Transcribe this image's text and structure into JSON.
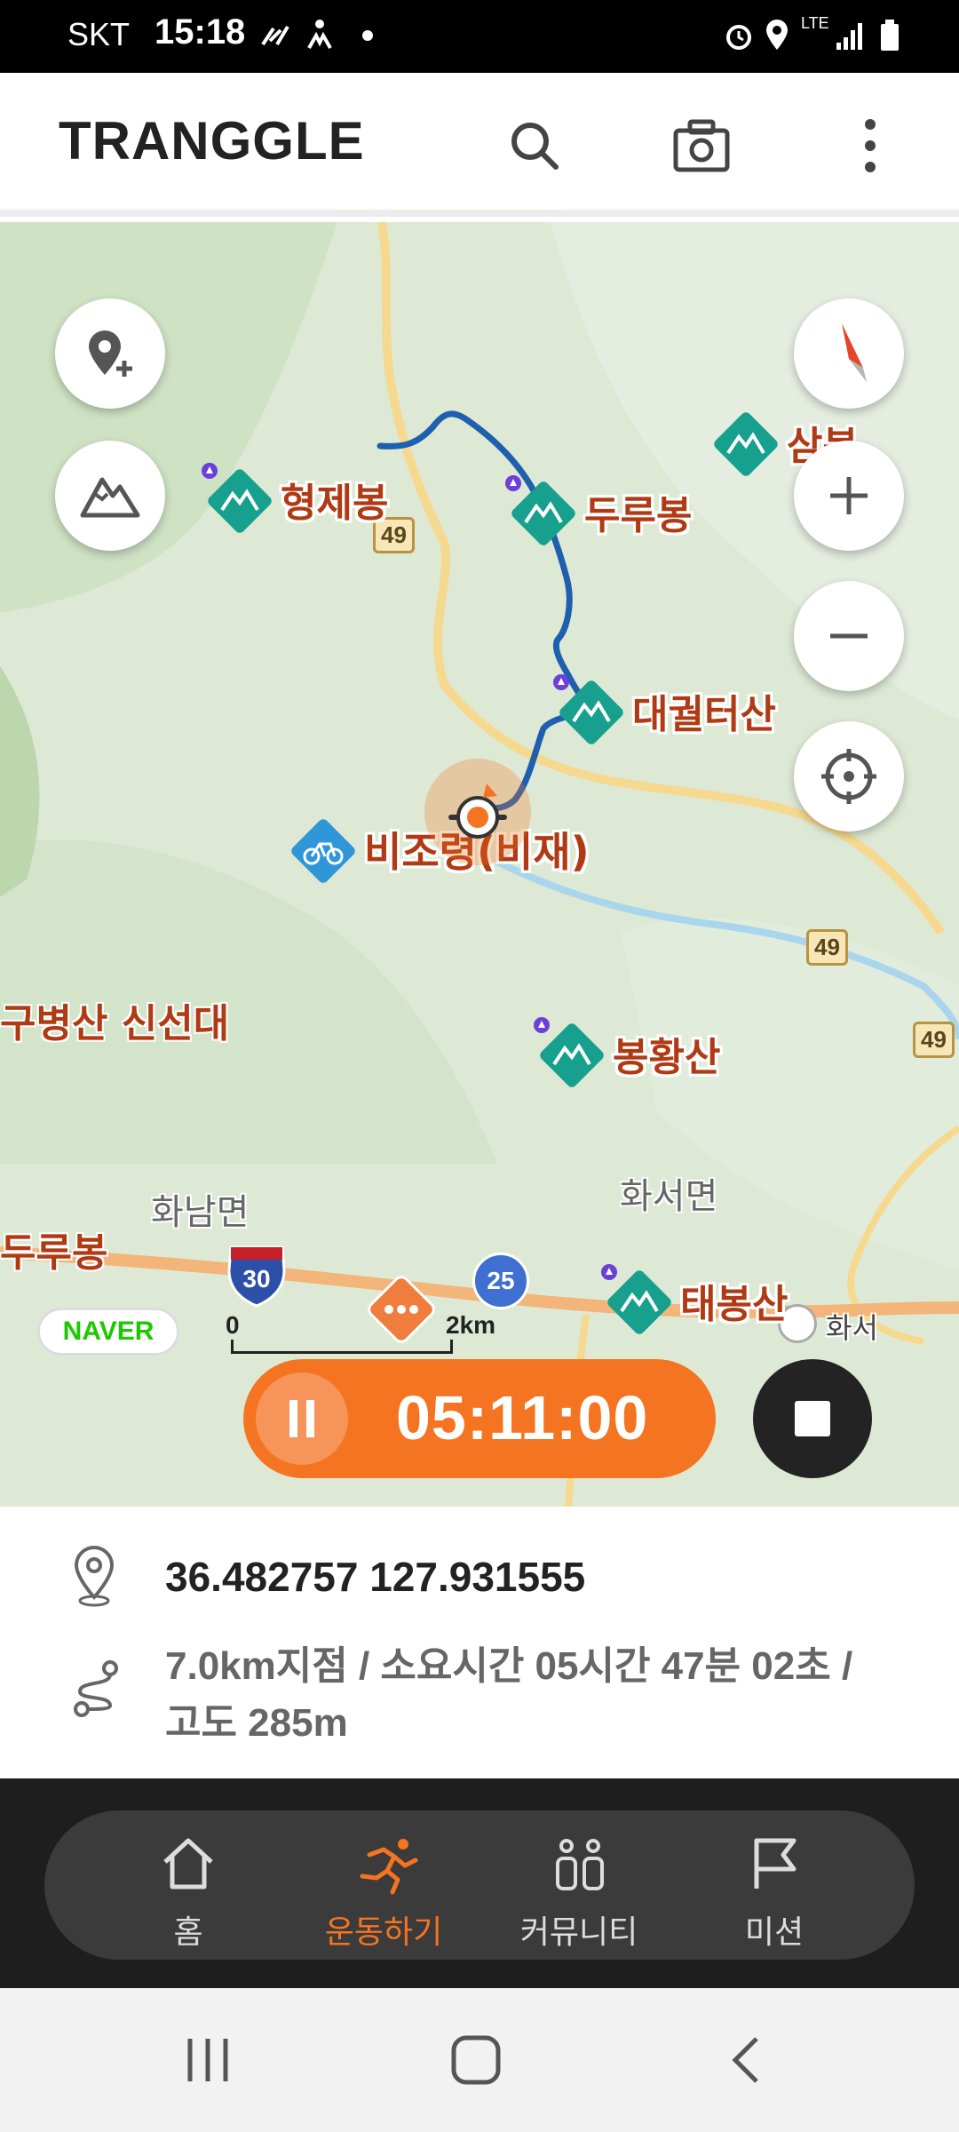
{
  "status_bar": {
    "carrier": "SKT",
    "time": "15:18",
    "icons": [
      "run-activity-icon",
      "accessibility-icon",
      "dot-icon",
      "alarm-icon",
      "location-icon",
      "lte-icon",
      "signal-icon",
      "battery-icon"
    ],
    "lte_label": "LTE"
  },
  "header": {
    "logo": "TRANGGLE",
    "actions": [
      "search-icon",
      "camera-icon",
      "more-vert-icon"
    ]
  },
  "map": {
    "peaks": [
      {
        "name": "형제봉"
      },
      {
        "name": "두루봉"
      },
      {
        "name": "삼봉"
      },
      {
        "name": "대궐터산"
      },
      {
        "name": "봉황산"
      },
      {
        "name": "태봉산"
      }
    ],
    "poi": {
      "name": "비조령(비재)",
      "icon": "bicycle-icon"
    },
    "labels": {
      "peak_left": "구병산 신선대",
      "peak_left2": "두루봉",
      "town1": "화남면",
      "town2": "화서면",
      "town3": "화서"
    },
    "road_badges": [
      "49",
      "49",
      "49"
    ],
    "highway_badges": [
      "30",
      "25"
    ],
    "naver": "NAVER",
    "scale": {
      "start": "0",
      "end": "2km"
    },
    "timer": "05:11:00",
    "colors": {
      "route": "#1e5fae",
      "accent": "#f47421",
      "peak_marker": "#17a08d",
      "peak_label": "#b03a14"
    }
  },
  "info": {
    "coordinates": "36.482757 127.931555",
    "description": "7.0km지점 / 소요시간 05시간 47분 02초 / 고도 285m"
  },
  "bottom_nav": {
    "items": [
      {
        "label": "홈",
        "icon": "home-icon",
        "active": false
      },
      {
        "label": "운동하기",
        "icon": "running-icon",
        "active": true
      },
      {
        "label": "커뮤니티",
        "icon": "community-icon",
        "active": false
      },
      {
        "label": "미션",
        "icon": "flag-icon",
        "active": false
      }
    ]
  }
}
